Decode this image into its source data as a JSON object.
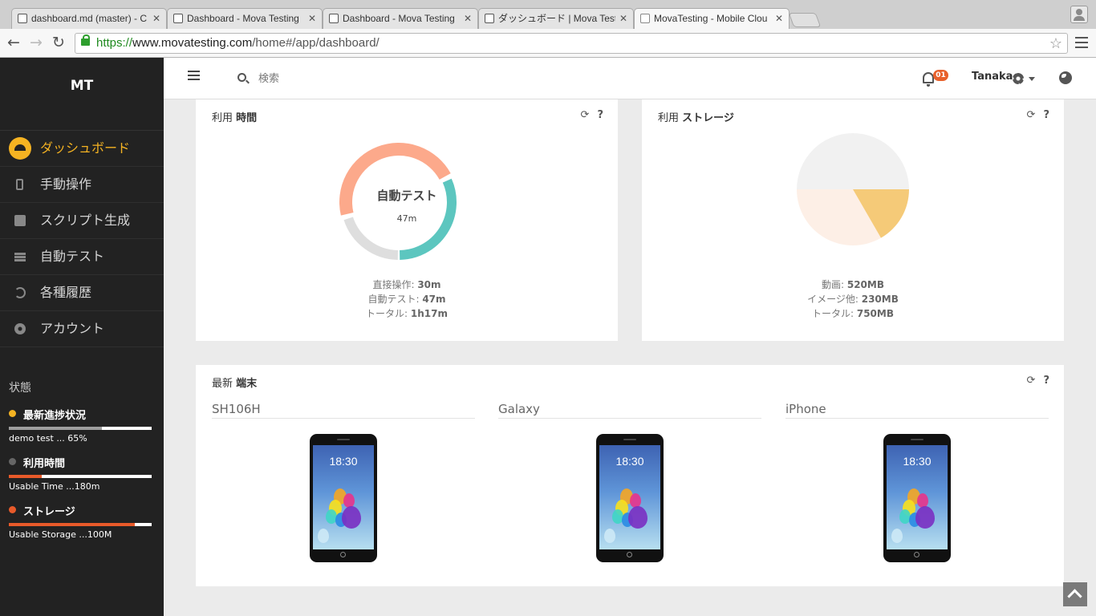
{
  "browser": {
    "tabs": [
      {
        "label": "dashboard.md (master) - C"
      },
      {
        "label": "Dashboard - Mova Testing"
      },
      {
        "label": "Dashboard - Mova Testing"
      },
      {
        "label": "ダッシュボード | Mova Test"
      },
      {
        "label": "MovaTesting - Mobile Clou"
      }
    ],
    "url_scheme": "https://",
    "url_host": "www.movatesting.com",
    "url_path": "/home#/app/dashboard/"
  },
  "sidebar": {
    "logo": "MT",
    "nav": [
      {
        "label": "ダッシュボード",
        "icon": "dashboard-icon"
      },
      {
        "label": "手動操作",
        "icon": "phone-icon"
      },
      {
        "label": "スクリプト生成",
        "icon": "edit-icon"
      },
      {
        "label": "自動テスト",
        "icon": "list-icon"
      },
      {
        "label": "各種履歴",
        "icon": "history-icon"
      },
      {
        "label": "アカウント",
        "icon": "gear-icon"
      }
    ],
    "status_title": "状態",
    "status": [
      {
        "label": "最新進捗状況",
        "sub": "demo test ... 65%",
        "color": "#f5b322",
        "bar_color": "#9e9e9e",
        "progress": 0.65
      },
      {
        "label": "利用時間",
        "sub": "Usable Time ...180m",
        "color": "#666666",
        "bar_color": "#e85a2a",
        "progress": 0.23
      },
      {
        "label": "ストレージ",
        "sub": "Usable Storage ...100M",
        "color": "#e85a2a",
        "bar_color": "#e85a2a",
        "progress": 0.88
      }
    ]
  },
  "header": {
    "search_placeholder": "検索",
    "notification_count": "01",
    "user_name": "Tanaka"
  },
  "usage_time": {
    "title_prefix": "利用 ",
    "title_bold": "時間",
    "center_title": "自動テスト",
    "center_value": "47m",
    "legend": [
      {
        "label": "直接操作: ",
        "value": "30m"
      },
      {
        "label": "自動テスト: ",
        "value": "47m"
      },
      {
        "label": "トータル: ",
        "value": "1h17m"
      }
    ],
    "colors": {
      "highlight": "#fca98b",
      "auto": "#5cc6bf",
      "rest": "#dedede"
    }
  },
  "usage_storage": {
    "title_prefix": "利用 ",
    "title_bold": "ストレージ",
    "legend": [
      {
        "label": "動画: ",
        "value": "520MB"
      },
      {
        "label": "イメージ他: ",
        "value": "230MB"
      },
      {
        "label": "トータル: ",
        "value": "750MB"
      }
    ],
    "colors": {
      "video": "#fdefe6",
      "image": "#f5ca78",
      "free": "#f1f1f1"
    }
  },
  "devices": {
    "title_prefix": "最新 ",
    "title_bold": "端末",
    "items": [
      {
        "name": "SH106H",
        "screen_time": "18:30"
      },
      {
        "name": "Galaxy",
        "screen_time": "18:30"
      },
      {
        "name": "iPhone",
        "screen_time": "18:30"
      }
    ]
  }
}
